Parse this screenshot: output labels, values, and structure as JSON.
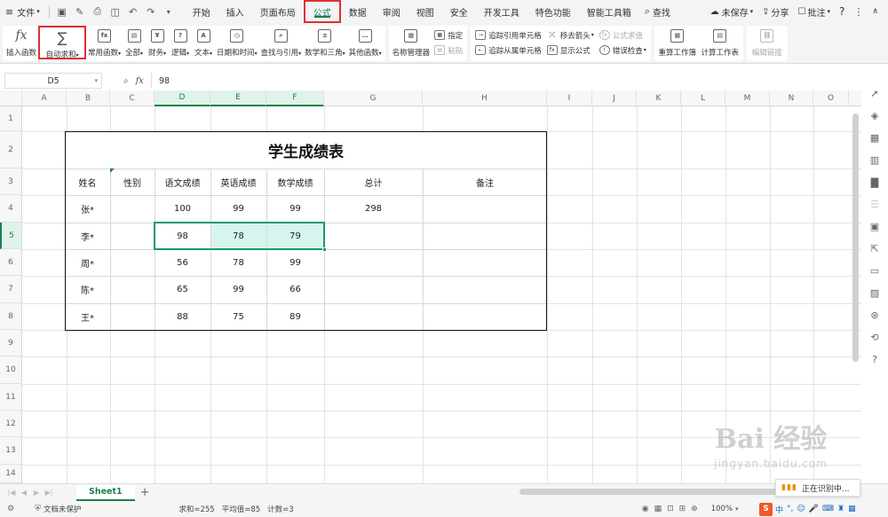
{
  "menubar": {
    "file_label": "文件",
    "tabs": [
      "开始",
      "插入",
      "页面布局",
      "公式",
      "数据",
      "审阅",
      "视图",
      "安全",
      "开发工具",
      "特色功能",
      "智能工具箱"
    ],
    "active_tab": "公式",
    "search_label": "查找",
    "unsaved_label": "未保存",
    "share_label": "分享",
    "comment_label": "批注",
    "help_label": "?"
  },
  "ribbon": {
    "insert_function": "插入函数",
    "auto_sum": "自动求和",
    "common_functions": "常用函数",
    "all": "全部",
    "finance": "财务",
    "logic": "逻辑",
    "text": "文本",
    "datetime": "日期和时间",
    "lookup": "查找与引用",
    "math": "数学和三角",
    "other": "其他函数",
    "name_manager": "名称管理器",
    "specify": "指定",
    "paste": "粘贴",
    "trace_precedents": "追踪引用单元格",
    "trace_dependents": "追踪从属单元格",
    "remove_arrows": "移去箭头",
    "show_formulas": "显示公式",
    "formula_eval": "公式求值",
    "error_check": "错误检查",
    "recalc_workbook": "重算工作簿",
    "calc_sheet": "计算工作表",
    "edit_links": "编辑链接"
  },
  "formula_bar": {
    "cell_ref": "D5",
    "fx": "fx",
    "value": "98"
  },
  "columns": [
    "A",
    "B",
    "C",
    "D",
    "E",
    "F",
    "G",
    "H",
    "I",
    "J",
    "K",
    "L",
    "M",
    "N",
    "O"
  ],
  "rows": [
    "1",
    "2",
    "3",
    "4",
    "5",
    "6",
    "7",
    "8",
    "9",
    "10",
    "11",
    "12",
    "13",
    "14"
  ],
  "sheet": {
    "title": "学生成绩表",
    "headers": [
      "姓名",
      "性别",
      "语文成绩",
      "英语成绩",
      "数学成绩",
      "总计",
      "备注"
    ],
    "data": [
      [
        "张*",
        "",
        "100",
        "99",
        "99",
        "298",
        ""
      ],
      [
        "李*",
        "",
        "98",
        "78",
        "79",
        "",
        ""
      ],
      [
        "周*",
        "",
        "56",
        "78",
        "99",
        "",
        ""
      ],
      [
        "陈*",
        "",
        "65",
        "99",
        "66",
        "",
        ""
      ],
      [
        "王*",
        "",
        "88",
        "75",
        "89",
        "",
        ""
      ]
    ]
  },
  "sheet_tabs": {
    "active": "Sheet1",
    "add": "+"
  },
  "statusbar": {
    "protect": "文档未保护",
    "sum": "求和=255",
    "avg": "平均值=85",
    "count": "计数=3",
    "zoom": "100%"
  },
  "overlay": {
    "recognizing": "正在识别中...",
    "ime_label": "中",
    "watermark_main": "Bai 经验",
    "watermark_sub": "jingyan.baidu.com"
  },
  "colors": {
    "accent": "#1a7f48",
    "highlight": "#e03030",
    "selection_fill": "#d6f5ef"
  }
}
